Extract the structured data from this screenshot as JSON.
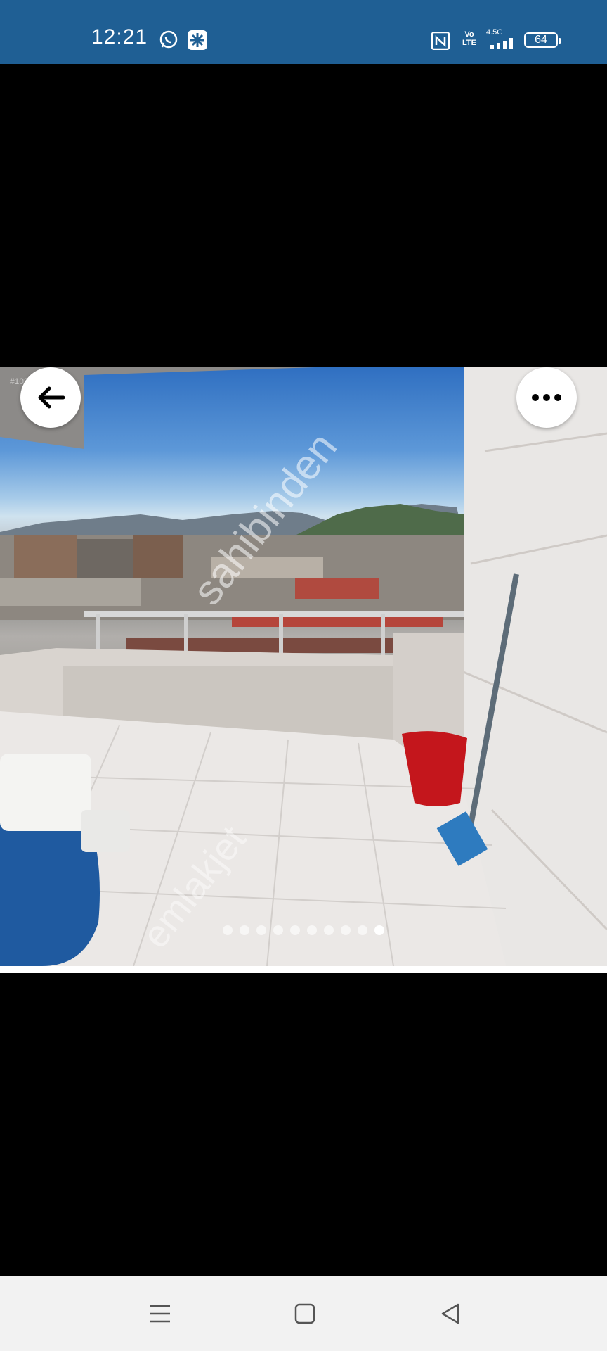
{
  "status_bar": {
    "time": "12:21",
    "left_icons": [
      "whatsapp-icon",
      "app-notification-icon"
    ],
    "right_icons": [
      "nfc-icon",
      "volte-icon",
      "signal-4-5g-icon"
    ],
    "network_label": "4.5G",
    "volte_label": "Vo LTE",
    "battery_level": "64",
    "colors": {
      "background": "#1f5f94"
    }
  },
  "photo_viewer": {
    "listing_id": "#1087156053",
    "watermark": "sahibinden",
    "watermark_secondary": "emlakjet",
    "back_button": {
      "icon": "arrow-left-icon"
    },
    "more_button": {
      "icon": "more-horizontal-icon"
    },
    "pagination": {
      "total": 10,
      "active_index": 10
    }
  },
  "nav_bar": {
    "buttons": [
      "menu-icon",
      "home-square-icon",
      "back-triangle-icon"
    ],
    "background": "#f2f2f2"
  }
}
